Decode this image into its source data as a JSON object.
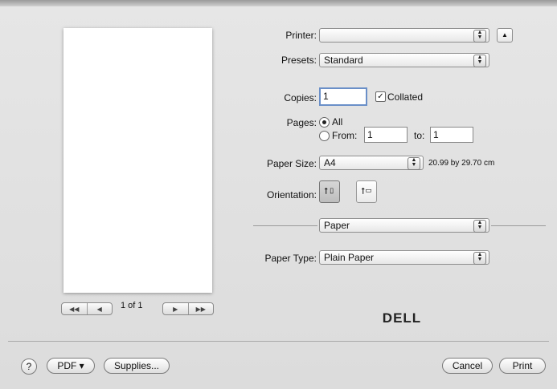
{
  "preview": {
    "page_indicator": "1 of 1"
  },
  "printer": {
    "label": "Printer:",
    "value": ""
  },
  "presets": {
    "label": "Presets:",
    "value": "Standard"
  },
  "copies": {
    "label": "Copies:",
    "value": "1",
    "collated_label": "Collated",
    "collated_checked": true
  },
  "pages": {
    "label": "Pages:",
    "all_label": "All",
    "from_label": "From:",
    "from_value": "1",
    "to_label": "to:",
    "to_value": "1"
  },
  "paper_size": {
    "label": "Paper Size:",
    "value": "A4",
    "dimensions": "20.99 by 29.70 cm"
  },
  "orientation": {
    "label": "Orientation:"
  },
  "section_popup": {
    "value": "Paper"
  },
  "paper_type": {
    "label": "Paper Type:",
    "value": "Plain Paper"
  },
  "brand": {
    "logo_text": "DELL"
  },
  "footer": {
    "help": "?",
    "pdf": "PDF ▾",
    "supplies": "Supplies...",
    "cancel": "Cancel",
    "print": "Print"
  }
}
